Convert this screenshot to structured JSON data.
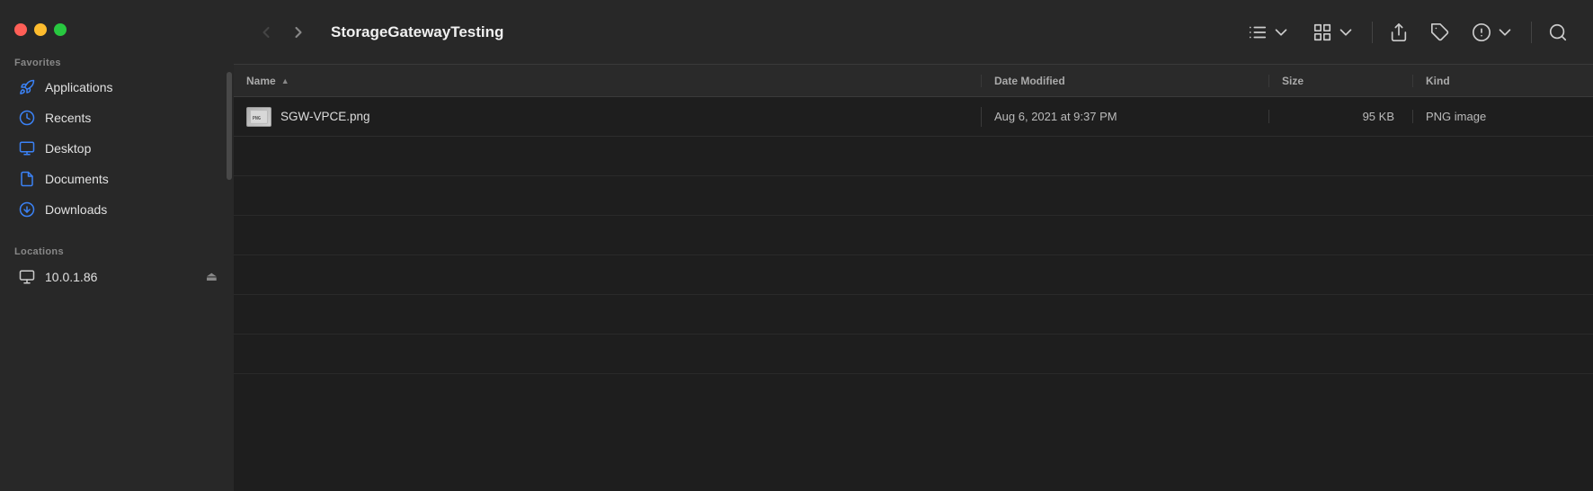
{
  "window": {
    "title": "StorageGatewayTesting"
  },
  "traffic_lights": {
    "close_label": "close",
    "minimize_label": "minimize",
    "maximize_label": "maximize"
  },
  "sidebar": {
    "favorites_header": "Favorites",
    "locations_header": "Locations",
    "items": [
      {
        "id": "applications",
        "label": "Applications",
        "icon": "rocket-icon"
      },
      {
        "id": "recents",
        "label": "Recents",
        "icon": "clock-icon"
      },
      {
        "id": "desktop",
        "label": "Desktop",
        "icon": "desktop-icon"
      },
      {
        "id": "documents",
        "label": "Documents",
        "icon": "doc-icon"
      },
      {
        "id": "downloads",
        "label": "Downloads",
        "icon": "download-icon"
      }
    ],
    "locations": [
      {
        "id": "network",
        "label": "10.0.1.86",
        "icon": "monitor-icon",
        "eject": true
      }
    ]
  },
  "toolbar": {
    "back_label": "‹",
    "forward_label": "›",
    "title": "StorageGatewayTesting",
    "list_view_label": "list view",
    "grid_view_label": "grid view",
    "share_label": "share",
    "tag_label": "tag",
    "more_label": "more",
    "search_label": "search"
  },
  "table": {
    "col_name": "Name",
    "col_date": "Date Modified",
    "col_size": "Size",
    "col_kind": "Kind",
    "rows": [
      {
        "name": "SGW-VPCE.png",
        "date_modified": "Aug 6, 2021 at 9:37 PM",
        "size": "95 KB",
        "kind": "PNG image"
      }
    ]
  }
}
